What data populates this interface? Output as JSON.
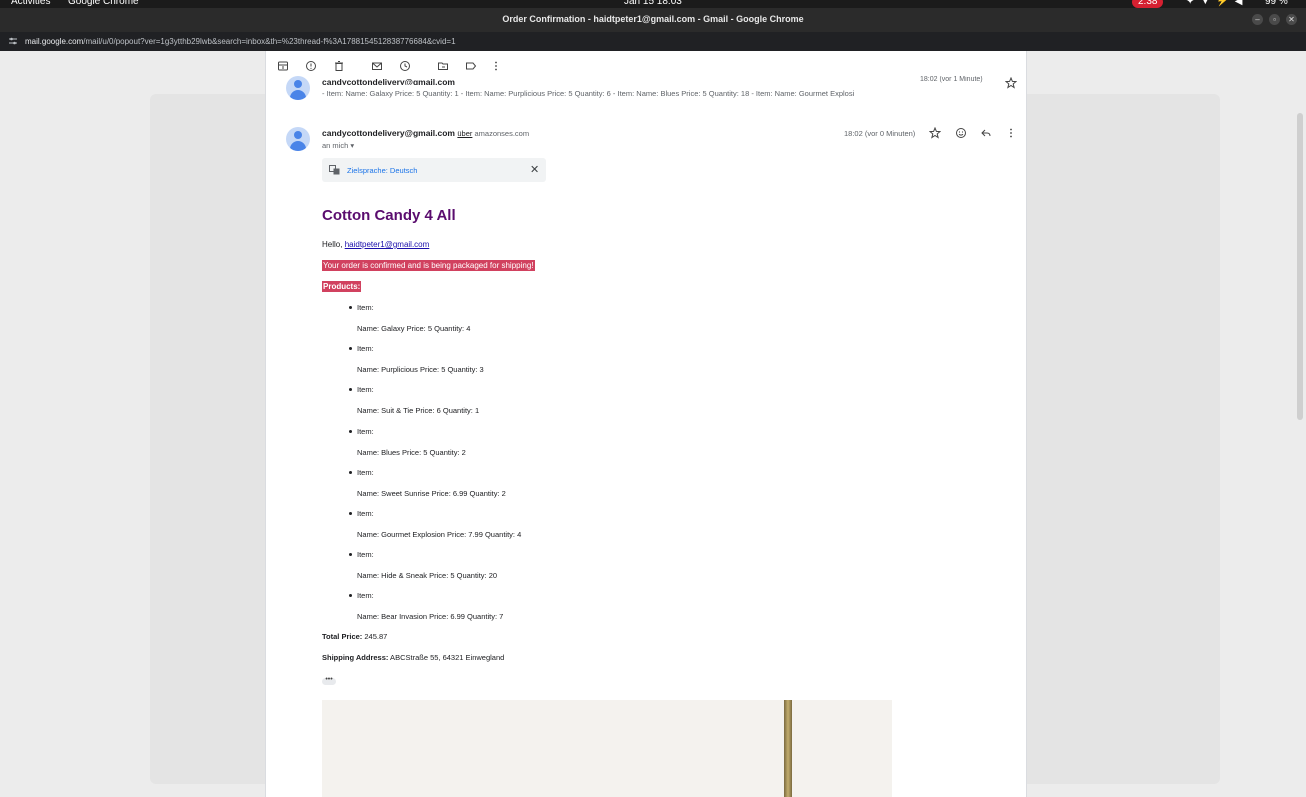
{
  "system_bar": {
    "activities": "Activities",
    "app": "Google Chrome",
    "clock": "Jan 15  18:03",
    "recording": "2:38",
    "battery": "99 %"
  },
  "window": {
    "title": "Order Confirmation - haidtpeter1@gmail.com - Gmail - Google Chrome"
  },
  "urlbar": {
    "host": "mail.google.com",
    "path": "/mail/u/0/popout?ver=1g3ytthb29lwb&search=inbox&th=%23thread-f%3A1788154512838776684&cvid=1"
  },
  "toolbar": {
    "icons": [
      "archive-icon",
      "report-spam-icon",
      "delete-icon",
      "mark-unread-icon",
      "snooze-icon",
      "move-to-icon",
      "label-icon",
      "more-vert-icon"
    ]
  },
  "thread": {
    "previous": {
      "sender": "candycottondelivery@gmail.com",
      "snippet": "- Item: Name: Galaxy Price: 5 Quantity: 1 - Item: Name: Purplicious Price: 5 Quantity: 6 - Item: Name: Blues Price: 5 Quantity: 18 - Item: Name: Gourmet Explosi",
      "time": "18:02 (vor 1 Minute)"
    },
    "current": {
      "sender": "candycottondelivery@gmail.com",
      "via_word": "über",
      "via_domain": "amazonses.com",
      "recipient": "an mich",
      "time": "18:02 (vor 0 Minuten)"
    }
  },
  "translate": {
    "label": "Zielsprache: Deutsch",
    "close": "✕"
  },
  "email": {
    "brand": "Cotton Candy 4 All",
    "hello_prefix": "Hello, ",
    "hello_email": "haidtpeter1@gmail.com",
    "confirmation": "Your order is confirmed and is being packaged for shipping!",
    "products_label": "Products:",
    "item_label": "Item:",
    "items": [
      {
        "name": "Name: Galaxy Price: 5 Quantity: 4"
      },
      {
        "name": "Name: Purplicious Price: 5 Quantity: 3"
      },
      {
        "name": "Name: Suit & Tie Price: 6 Quantity: 1"
      },
      {
        "name": "Name: Blues Price: 5 Quantity: 2"
      },
      {
        "name": "Name: Sweet Sunrise Price: 6.99 Quantity: 2"
      },
      {
        "name": "Name: Gourmet Explosion Price: 7.99 Quantity: 4"
      },
      {
        "name": "Name: Hide & Sneak Price: 5 Quantity: 20"
      },
      {
        "name": "Name: Bear Invasion Price: 6.99 Quantity: 7"
      }
    ],
    "total_label": "Total Price:",
    "total_value": " 245.87",
    "shipping_label": "Shipping Address:",
    "shipping_value": " ABCStraße 55, 64321 Einwegland",
    "more": "•••"
  }
}
